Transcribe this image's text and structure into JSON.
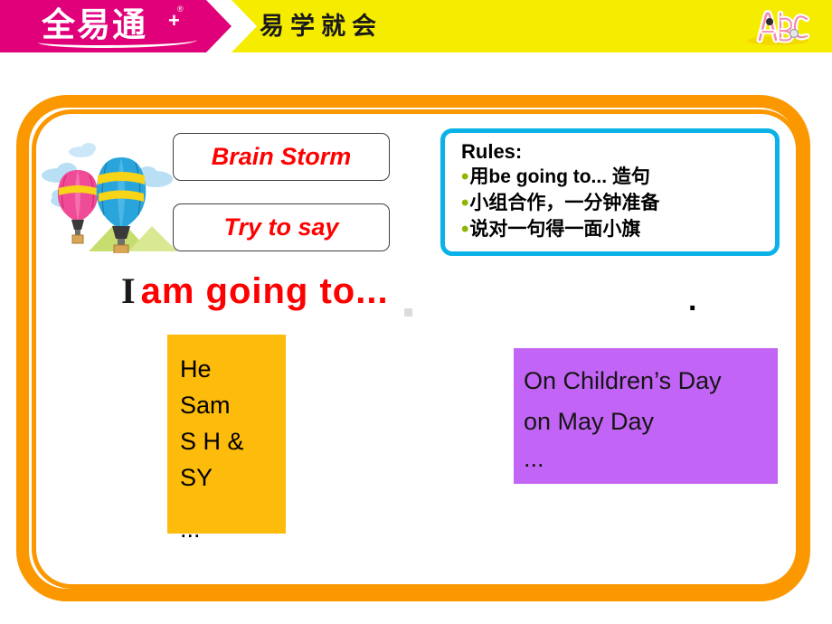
{
  "header": {
    "brand_name": "全易通",
    "brand_registered_mark": "®",
    "brand_plus": "+",
    "slogan": "易学就会",
    "abc_logo_label": "ABC",
    "colors": {
      "brand_band": "#e0007a",
      "bar": "#f5ec00"
    }
  },
  "frame": {
    "color": "#fb9800"
  },
  "illustration": {
    "name": "hot-air-balloons",
    "balloon_large_color": "#2aa5dc",
    "balloon_large_stripe_color": "#f7d417",
    "balloon_small_color": "#ef4b96",
    "balloon_small_stripe_color": "#f7d417",
    "cloud_color": "#b9dff5",
    "hill_color": "#c8dd6f"
  },
  "titles": {
    "brain_storm": "Brain Storm",
    "try_to_say": "Try to say",
    "text_color": "#ff0000"
  },
  "rules": {
    "title": "Rules:",
    "border_color": "#0bb2e8",
    "bullet_color": "#8db600",
    "bullet_glyph": "•",
    "items": [
      "用be going to... 造句",
      "小组合作，一分钟准备",
      "说对一句得一面小旗"
    ]
  },
  "sentence": {
    "subject": "I",
    "predicate": "am going to...",
    "period": "."
  },
  "subject_box": {
    "background": "#fdbb0b",
    "items": [
      "He",
      "Sam",
      "S  H   &",
      "SY"
    ],
    "ellipsis": "..."
  },
  "time_box": {
    "background": "#c264f5",
    "items": [
      "On Children’s Day",
      "on May Day"
    ],
    "ellipsis": "..."
  }
}
